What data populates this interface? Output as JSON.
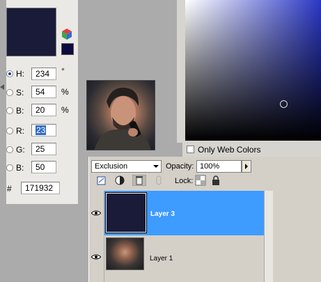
{
  "color_picker": {
    "new_color": "#1a1b39",
    "web_safe_color": "#0b0b40",
    "fields": [
      {
        "label": "H:",
        "value": "234",
        "unit": "°",
        "selected": true
      },
      {
        "label": "S:",
        "value": "54",
        "unit": "%"
      },
      {
        "label": "B:",
        "value": "20",
        "unit": "%"
      },
      {
        "label": "R:",
        "value": "23",
        "unit": "",
        "highlighted": true
      },
      {
        "label": "G:",
        "value": "25",
        "unit": ""
      },
      {
        "label": "B:",
        "value": "50",
        "unit": ""
      }
    ],
    "hex_label": "#",
    "hex_value": "171932",
    "only_web_colors_label": "Only Web Colors",
    "only_web_colors_checked": false
  },
  "layers_panel": {
    "blend_mode": "Exclusion",
    "opacity_label": "Opacity:",
    "opacity_value": "100%",
    "lock_label": "Lock:",
    "layers": [
      {
        "name": "Layer 3",
        "selected": true,
        "thumb_color": "#1a1b39"
      },
      {
        "name": "Layer 1",
        "selected": false
      }
    ]
  },
  "colors": {
    "selection_blue": "#3e9bff",
    "panel_gray": "#d4d0c8"
  }
}
